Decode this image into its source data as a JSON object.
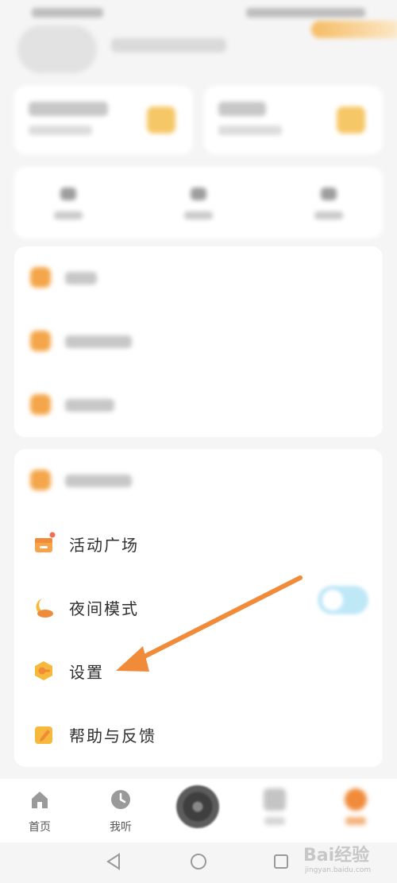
{
  "menu": {
    "items": [
      {
        "label": "活动广场"
      },
      {
        "label": "夜间模式"
      },
      {
        "label": "设置"
      },
      {
        "label": "帮助与反馈"
      }
    ]
  },
  "night_mode": {
    "enabled": false
  },
  "bottom_nav": {
    "tabs": [
      {
        "label": "首页",
        "icon": "home-icon"
      },
      {
        "label": "我听",
        "icon": "clock-icon"
      }
    ]
  },
  "watermark": {
    "brand": "Bai经验",
    "url": "jingyan.baidu.com"
  },
  "colors": {
    "accent_orange": "#f08b3a",
    "icon_yellow": "#f6b93b"
  }
}
